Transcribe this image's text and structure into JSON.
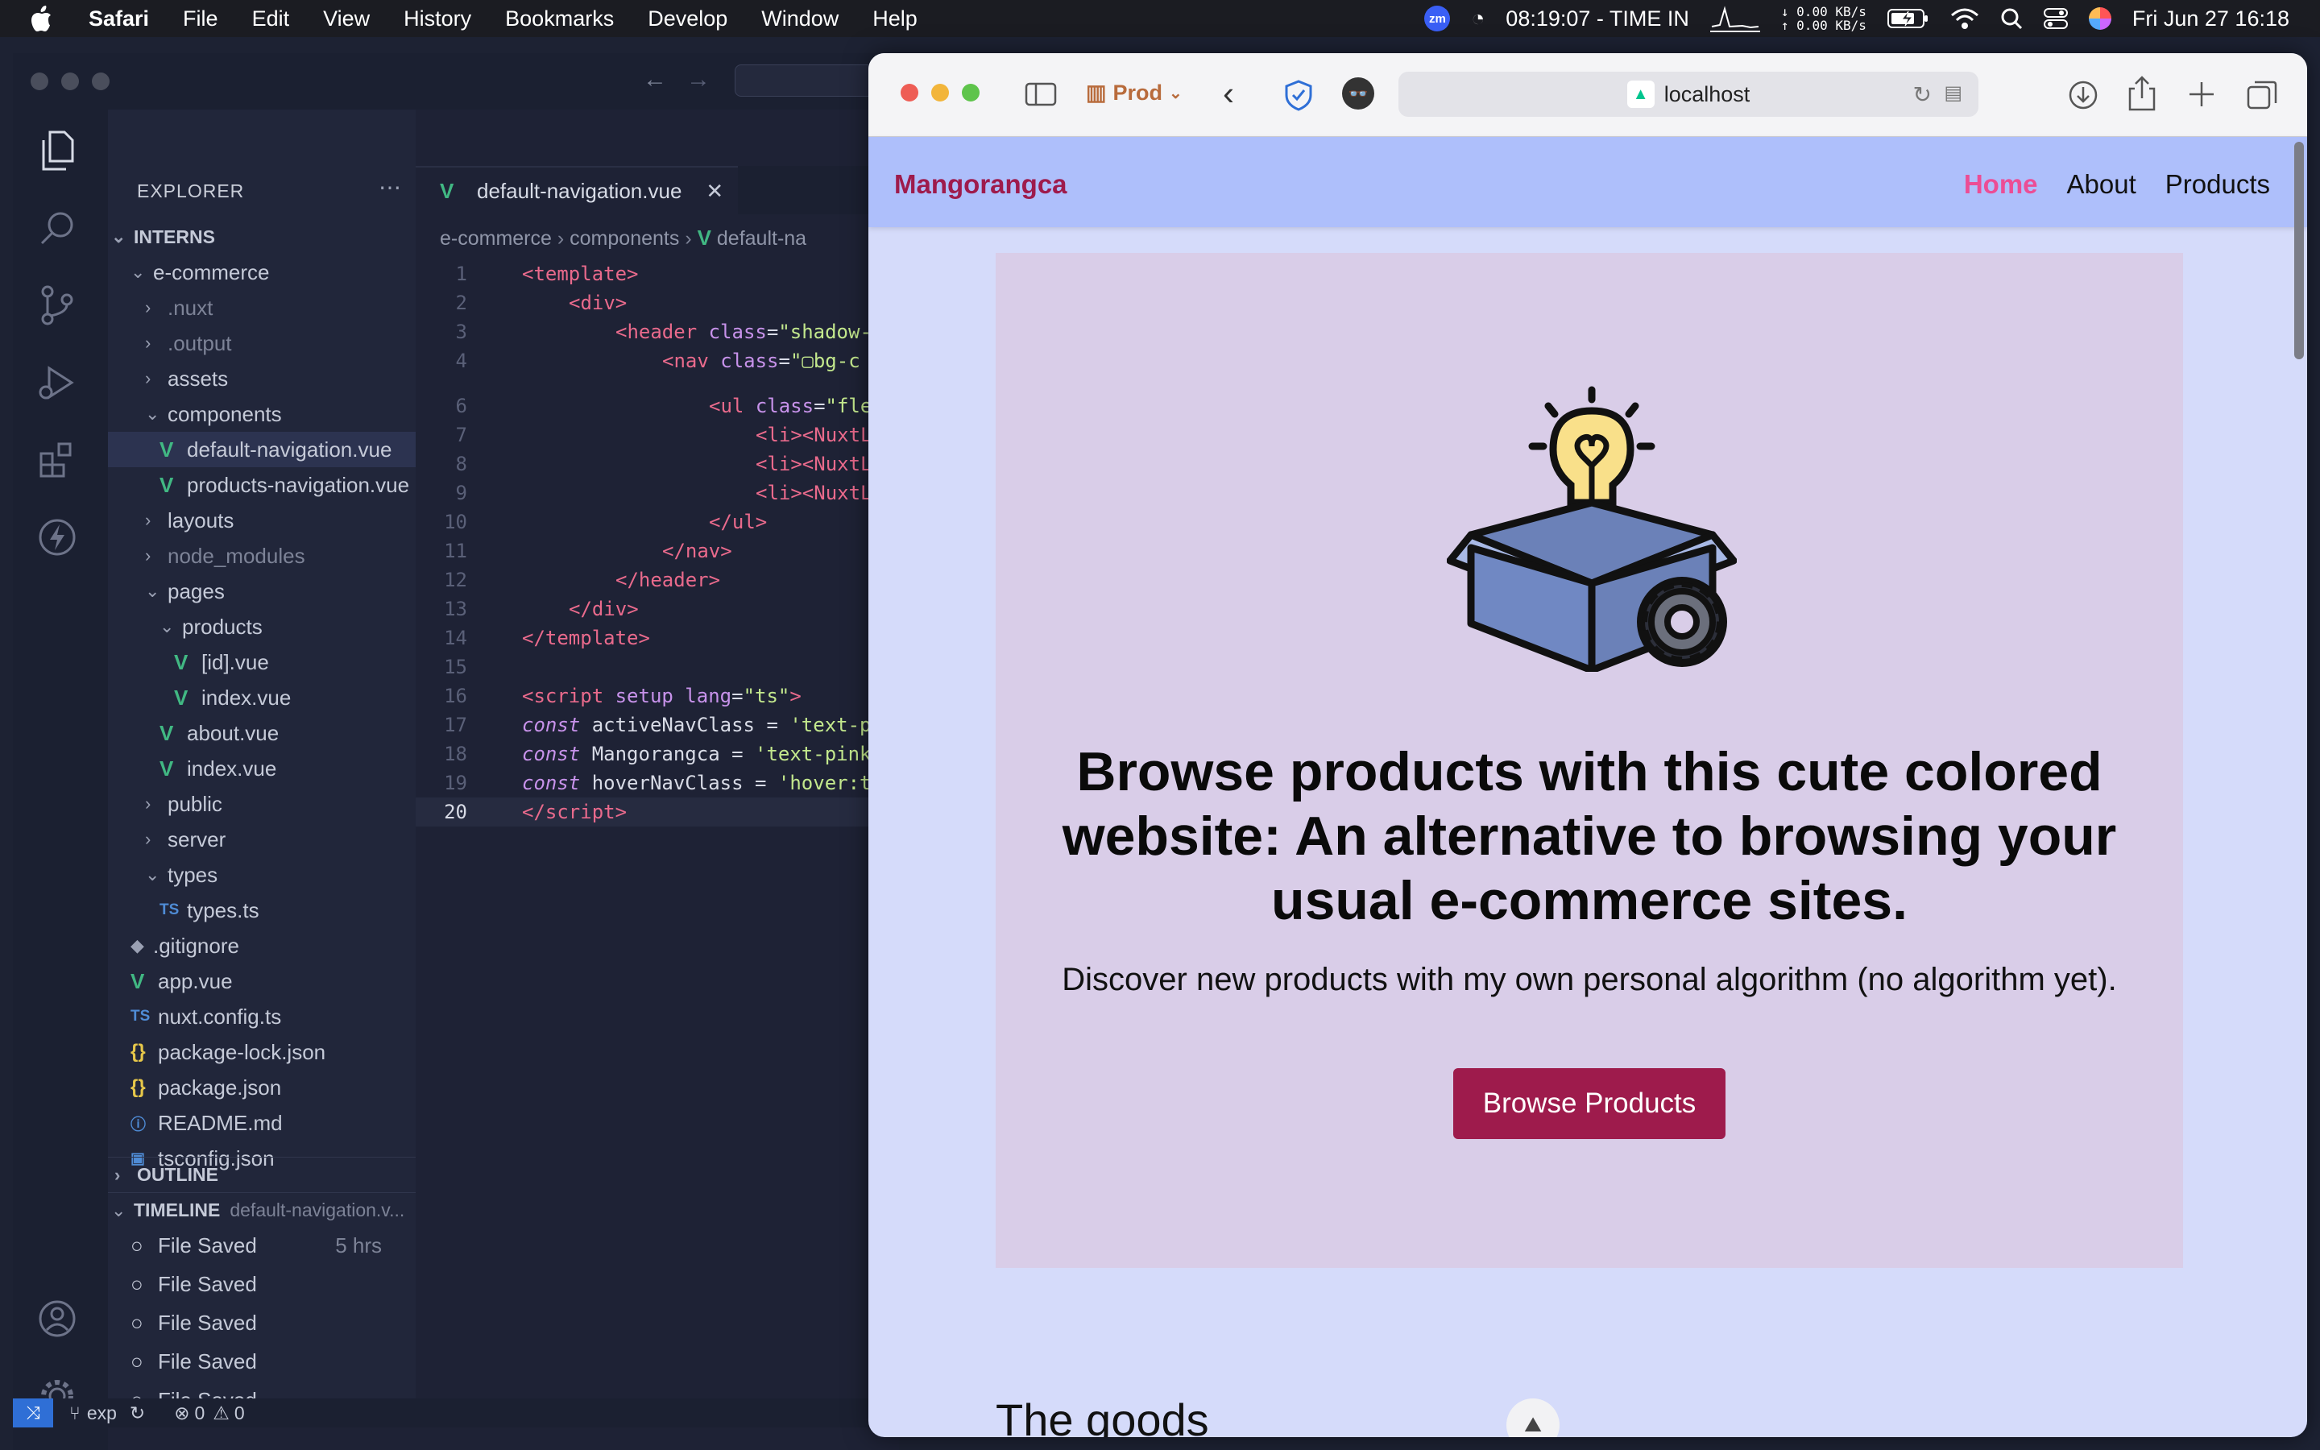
{
  "menubar": {
    "app": "Safari",
    "items": [
      "File",
      "Edit",
      "View",
      "History",
      "Bookmarks",
      "Develop",
      "Window",
      "Help"
    ],
    "zoom_badge": "zm",
    "timer": "08:19:07 - TIME IN",
    "net_down": "0.00 KB/s",
    "net_up": "0.00 KB/s",
    "datetime": "Fri Jun 27  16:18"
  },
  "vscode": {
    "explorer_title": "EXPLORER",
    "workspace": "INTERNS",
    "tree": [
      {
        "label": "e-commerce",
        "kind": "folder-open"
      },
      {
        "label": ".nuxt",
        "kind": "folder",
        "dim": true
      },
      {
        "label": ".output",
        "kind": "folder",
        "dim": true
      },
      {
        "label": "assets",
        "kind": "folder"
      },
      {
        "label": "components",
        "kind": "folder-open"
      },
      {
        "label": "default-navigation.vue",
        "kind": "vue",
        "selected": true
      },
      {
        "label": "products-navigation.vue",
        "kind": "vue"
      },
      {
        "label": "layouts",
        "kind": "folder"
      },
      {
        "label": "node_modules",
        "kind": "folder",
        "dim": true
      },
      {
        "label": "pages",
        "kind": "folder-open"
      },
      {
        "label": "products",
        "kind": "folder-open"
      },
      {
        "label": "[id].vue",
        "kind": "vue"
      },
      {
        "label": "index.vue",
        "kind": "vue"
      },
      {
        "label": "about.vue",
        "kind": "vue"
      },
      {
        "label": "index.vue",
        "kind": "vue"
      },
      {
        "label": "public",
        "kind": "folder"
      },
      {
        "label": "server",
        "kind": "folder"
      },
      {
        "label": "types",
        "kind": "folder-open"
      },
      {
        "label": "types.ts",
        "kind": "ts"
      },
      {
        "label": ".gitignore",
        "kind": "git"
      },
      {
        "label": "app.vue",
        "kind": "vue"
      },
      {
        "label": "nuxt.config.ts",
        "kind": "ts"
      },
      {
        "label": "package-lock.json",
        "kind": "json"
      },
      {
        "label": "package.json",
        "kind": "json"
      },
      {
        "label": "README.md",
        "kind": "info"
      },
      {
        "label": "tsconfig.json",
        "kind": "tsjson"
      }
    ],
    "outline": "OUTLINE",
    "timeline": "TIMELINE",
    "timeline_file": "default-navigation.v...",
    "timeline_items": [
      {
        "label": "File Saved",
        "time": "5 hrs"
      },
      {
        "label": "File Saved",
        "time": ""
      },
      {
        "label": "File Saved",
        "time": ""
      },
      {
        "label": "File Saved",
        "time": ""
      },
      {
        "label": "File Saved",
        "time": ""
      }
    ],
    "tab_label": "default-navigation.vue",
    "breadcrumb": [
      "e-commerce",
      "components",
      "default-na"
    ],
    "code_lines": [
      {
        "n": "1",
        "html": "<span class='tag'>&lt;template&gt;</span>",
        "indent": 0
      },
      {
        "n": "2",
        "html": "<span class='tag'>&lt;div&gt;</span>",
        "indent": 1
      },
      {
        "n": "3",
        "html": "<span class='tag'>&lt;header</span> <span class='attr'>class</span>=<span class='str'>\"shadow-</span>",
        "indent": 2
      },
      {
        "n": "4",
        "html": "<span class='tag'>&lt;nav</span> <span class='attr'>class</span>=<span class='str'>\"▢bg-c</span>",
        "indent": 3
      },
      {
        "n": "6",
        "html": "<span class='tag'>&lt;ul</span> <span class='attr'>class</span>=<span class='str'>\"fle</span>",
        "indent": 4
      },
      {
        "n": "7",
        "html": "<span class='tag'>&lt;li&gt;&lt;NuxtL</span>",
        "indent": 5
      },
      {
        "n": "8",
        "html": "<span class='tag'>&lt;li&gt;&lt;NuxtL</span>",
        "indent": 5
      },
      {
        "n": "9",
        "html": "<span class='tag'>&lt;li&gt;&lt;NuxtL</span>",
        "indent": 5
      },
      {
        "n": "10",
        "html": "<span class='tag'>&lt;/ul&gt;</span>",
        "indent": 4
      },
      {
        "n": "11",
        "html": "<span class='tag'>&lt;/nav&gt;</span>",
        "indent": 3
      },
      {
        "n": "12",
        "html": "<span class='tag'>&lt;/header&gt;</span>",
        "indent": 2
      },
      {
        "n": "13",
        "html": "<span class='tag'>&lt;/div&gt;</span>",
        "indent": 1
      },
      {
        "n": "14",
        "html": "<span class='tag'>&lt;/template&gt;</span>",
        "indent": 0
      },
      {
        "n": "15",
        "html": "",
        "indent": 0
      },
      {
        "n": "16",
        "html": "<span class='tag'>&lt;script</span> <span class='attr'>setup lang</span>=<span class='str'>\"ts\"</span><span class='tag'>&gt;</span>",
        "indent": 0
      },
      {
        "n": "17",
        "html": "<span class='kw'>const</span> activeNavClass = <span class='str'>'text-p</span>",
        "indent": 0
      },
      {
        "n": "18",
        "html": "<span class='kw'>const</span> Mangorangca = <span class='str'>'text-pink</span>",
        "indent": 0
      },
      {
        "n": "19",
        "html": "<span class='kw'>const</span> hoverNavClass = <span class='str'>'hover:t</span>",
        "indent": 0
      },
      {
        "n": "20",
        "html": "<span class='tag'>&lt;/script&gt;</span>",
        "indent": 0
      }
    ],
    "status": {
      "branch": "exp",
      "errors": "0",
      "warnings": "0",
      "badge": "1"
    }
  },
  "safari": {
    "profile": "Prod",
    "url": "localhost",
    "brand": "Mangorangca",
    "nav": [
      "Home",
      "About",
      "Products"
    ],
    "hero_title": "Browse products with this cute colored website: An alternative to browsing your usual e-commerce sites.",
    "hero_sub": "Discover new products with my own personal algorithm (no algorithm yet).",
    "cta": "Browse Products",
    "section_title": "The goods"
  },
  "colors": {
    "brand": "#9e1b4c",
    "nav_active": "#ec4d95",
    "nav_bg": "#aebffb",
    "hero_bg": "#d9cde8",
    "page_bg": "#d5dbfa"
  }
}
